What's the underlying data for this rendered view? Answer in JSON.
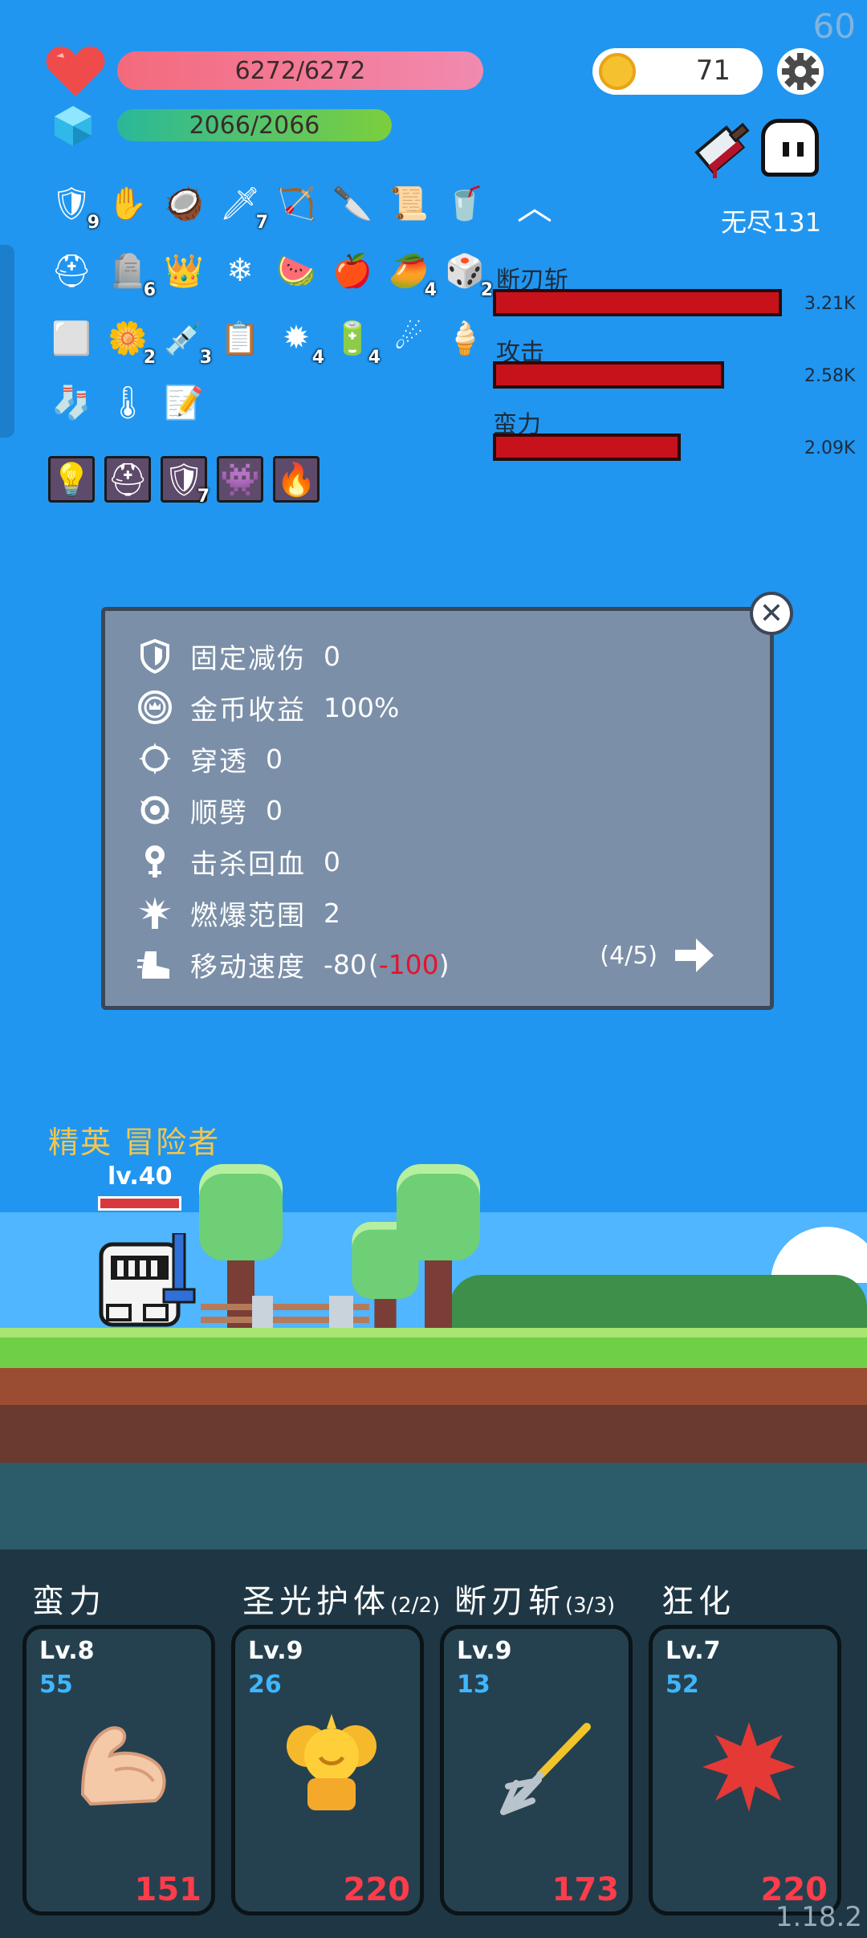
{
  "hud": {
    "fps": "60",
    "version": "1.18.2",
    "hp": "6272/6272",
    "mp": "2066/2066",
    "coins": "71",
    "mode": "无尽131"
  },
  "items": {
    "row1": [
      {
        "icon": "shield-icon",
        "glyph": "🛡",
        "count": "9"
      },
      {
        "icon": "glove-icon",
        "glyph": "✋",
        "count": ""
      },
      {
        "icon": "coconut-icon",
        "glyph": "🥥",
        "count": ""
      },
      {
        "icon": "sword-icon",
        "glyph": "🗡",
        "count": "7"
      },
      {
        "icon": "bow-icon",
        "glyph": "🏹",
        "count": ""
      },
      {
        "icon": "blade-icon",
        "glyph": "🔪",
        "count": ""
      },
      {
        "icon": "scroll-icon",
        "glyph": "📜",
        "count": ""
      },
      {
        "icon": "drink-icon",
        "glyph": "🥤",
        "count": ""
      }
    ],
    "row2": [
      {
        "icon": "viking-helmet-icon",
        "glyph": "⛑",
        "count": ""
      },
      {
        "icon": "tombstone-icon",
        "glyph": "🪦",
        "count": "6"
      },
      {
        "icon": "crown-icon",
        "glyph": "👑",
        "count": ""
      },
      {
        "icon": "snowflake-icon",
        "glyph": "❄",
        "count": ""
      },
      {
        "icon": "watermelon-icon",
        "glyph": "🍉",
        "count": ""
      },
      {
        "icon": "apple-icon",
        "glyph": "🍎",
        "count": ""
      },
      {
        "icon": "durian-icon",
        "glyph": "🥭",
        "count": "4"
      },
      {
        "icon": "dice-icon",
        "glyph": "🎲",
        "count": "2"
      }
    ],
    "row3": [
      {
        "icon": "ice-block-icon",
        "glyph": "⬜",
        "count": ""
      },
      {
        "icon": "flower-icon",
        "glyph": "🌼",
        "count": "2"
      },
      {
        "icon": "syringe-icon",
        "glyph": "💉",
        "count": "3"
      },
      {
        "icon": "notepad-icon",
        "glyph": "📋",
        "count": ""
      },
      {
        "icon": "spiked-ball-icon",
        "glyph": "✹",
        "count": "4"
      },
      {
        "icon": "battery-icon",
        "glyph": "🔋",
        "count": "4"
      },
      {
        "icon": "meteor-icon",
        "glyph": "☄",
        "count": ""
      },
      {
        "icon": "ice-cream-icon",
        "glyph": "🍦",
        "count": ""
      }
    ],
    "row4": [
      {
        "icon": "sock-icon",
        "glyph": "🧦",
        "count": ""
      },
      {
        "icon": "thermometer-icon",
        "glyph": "🌡",
        "count": ""
      },
      {
        "icon": "note-icon",
        "glyph": "📝",
        "count": ""
      }
    ],
    "row5": [
      {
        "icon": "lightbulb-tile-icon",
        "glyph": "💡",
        "count": ""
      },
      {
        "icon": "helmet-tile-icon",
        "glyph": "⛑",
        "count": ""
      },
      {
        "icon": "armor-tile-icon",
        "glyph": "🛡",
        "count": "7"
      },
      {
        "icon": "face-tile-icon",
        "glyph": "👾",
        "count": ""
      },
      {
        "icon": "fire-tile-icon",
        "glyph": "🔥",
        "count": ""
      }
    ]
  },
  "damage": [
    {
      "label": "断刃斩",
      "value": "3.21K",
      "fraction": 1.0
    },
    {
      "label": "攻击",
      "value": "2.58K",
      "fraction": 0.8
    },
    {
      "label": "蛮力",
      "value": "2.09K",
      "fraction": 0.65
    }
  ],
  "panel": {
    "stats": [
      {
        "icon": "shield-icon",
        "label": "固定减伤",
        "value": "0",
        "extra": ""
      },
      {
        "icon": "coin-crown-icon",
        "label": "金币收益",
        "value": "100%",
        "extra": ""
      },
      {
        "icon": "pierce-icon",
        "label": "穿透",
        "value": "0",
        "extra": ""
      },
      {
        "icon": "chain-icon",
        "label": "顺劈",
        "value": "0",
        "extra": ""
      },
      {
        "icon": "heal-icon",
        "label": "击杀回血",
        "value": "0",
        "extra": ""
      },
      {
        "icon": "burst-icon",
        "label": "燃爆范围",
        "value": "2",
        "extra": ""
      },
      {
        "icon": "boot-icon",
        "label": "移动速度",
        "value": "-80",
        "extra": "-100"
      }
    ],
    "page": "(4/5)"
  },
  "character": {
    "title": "精英 冒险者",
    "level": "lv.40"
  },
  "skills": [
    {
      "title": "蛮力",
      "sub": "",
      "lv": "Lv.8",
      "num": "55",
      "cost": "151",
      "icon": "bicep-icon"
    },
    {
      "title": "圣光护体",
      "sub": "(2/2)",
      "lv": "Lv.9",
      "num": "26",
      "cost": "220",
      "icon": "holy-light-icon"
    },
    {
      "title": "断刃斩",
      "sub": "(3/3)",
      "lv": "Lv.9",
      "num": "13",
      "cost": "173",
      "icon": "trident-icon"
    },
    {
      "title": "狂化",
      "sub": "",
      "lv": "Lv.7",
      "num": "52",
      "cost": "220",
      "icon": "rage-splat-icon"
    }
  ],
  "colors": {
    "background": "#2196f0",
    "hp": "#f46a7c",
    "mp": "#7ccf3c",
    "damage_bar": "#c8121b",
    "elite_title": "#f6c64a",
    "skill_cost": "#ff3c4a",
    "skill_num": "#3fb6ff"
  }
}
